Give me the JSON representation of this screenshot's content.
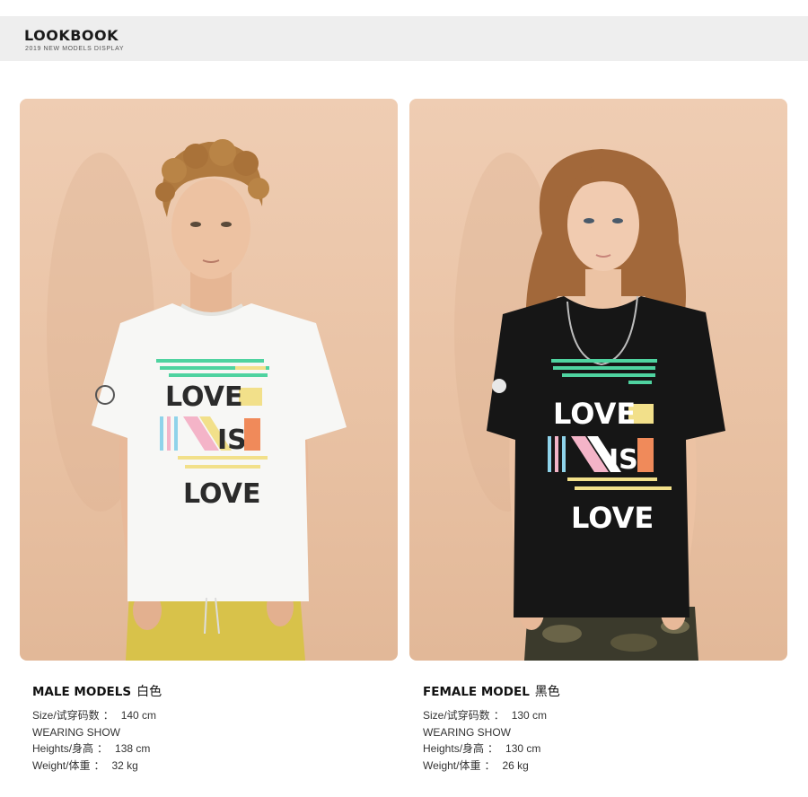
{
  "header": {
    "title": "LOOKBOOK",
    "subtitle": "2019 NEW MODELS DISPLAY"
  },
  "shirt_print": {
    "word1": "LOVE",
    "word2": "IS",
    "word3": "LOVE"
  },
  "models": [
    {
      "title": "MALE MODELS",
      "color": "白色",
      "size_label": "Size/试穿码数",
      "size_value": "140 cm",
      "show_label": "WEARING SHOW",
      "height_label": "Heights/身高",
      "height_value": "138 cm",
      "weight_label": "Weight/体重",
      "weight_value": "32 kg",
      "separator": "："
    },
    {
      "title": "FEMALE MODEL",
      "color": "黑色",
      "size_label": "Size/试穿码数",
      "size_value": "130 cm",
      "show_label": "WEARING SHOW",
      "height_label": "Heights/身高",
      "height_value": "130 cm",
      "weight_label": "Weight/体重",
      "weight_value": "26 kg",
      "separator": "："
    }
  ],
  "colors": {
    "backdrop": "#ebc6a9",
    "white_shirt": "#f7f7f5",
    "black_shirt": "#161616",
    "stripe_green": "#4fd3a0",
    "stripe_yellow": "#f2e08a",
    "stripe_orange": "#f08a5a",
    "stripe_pink": "#f4b4c8",
    "stripe_blue": "#8fd3ea"
  }
}
